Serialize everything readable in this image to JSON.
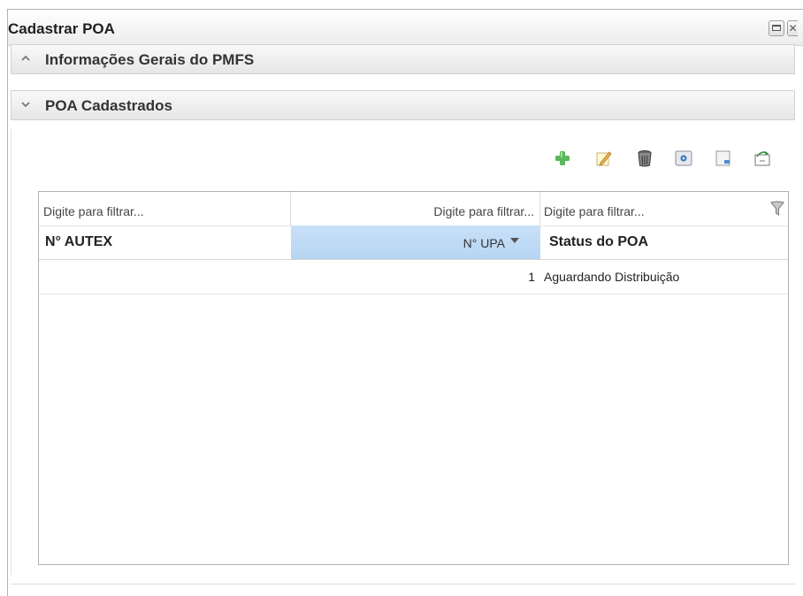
{
  "window": {
    "title": "Cadastrar POA"
  },
  "sections": [
    {
      "label": "Informações Gerais do PMFS",
      "state": "collapsed"
    },
    {
      "label": "POA Cadastrados",
      "state": "expanded"
    }
  ],
  "toolbar": {
    "icons": [
      "add-icon",
      "edit-icon",
      "delete-icon",
      "view-icon",
      "export-icon",
      "refresh-icon"
    ]
  },
  "grid": {
    "filters": [
      "Digite para filtrar...",
      "Digite para filtrar...",
      "Digite para filtrar..."
    ],
    "columns": [
      "N° AUTEX",
      "N° UPA",
      "Status do POA"
    ],
    "rows": [
      [
        "",
        "1",
        "Aguardando Distribuição"
      ]
    ]
  },
  "colors": {
    "sorted_header": "#c9e0f7",
    "add_green": "#5cb85c"
  }
}
